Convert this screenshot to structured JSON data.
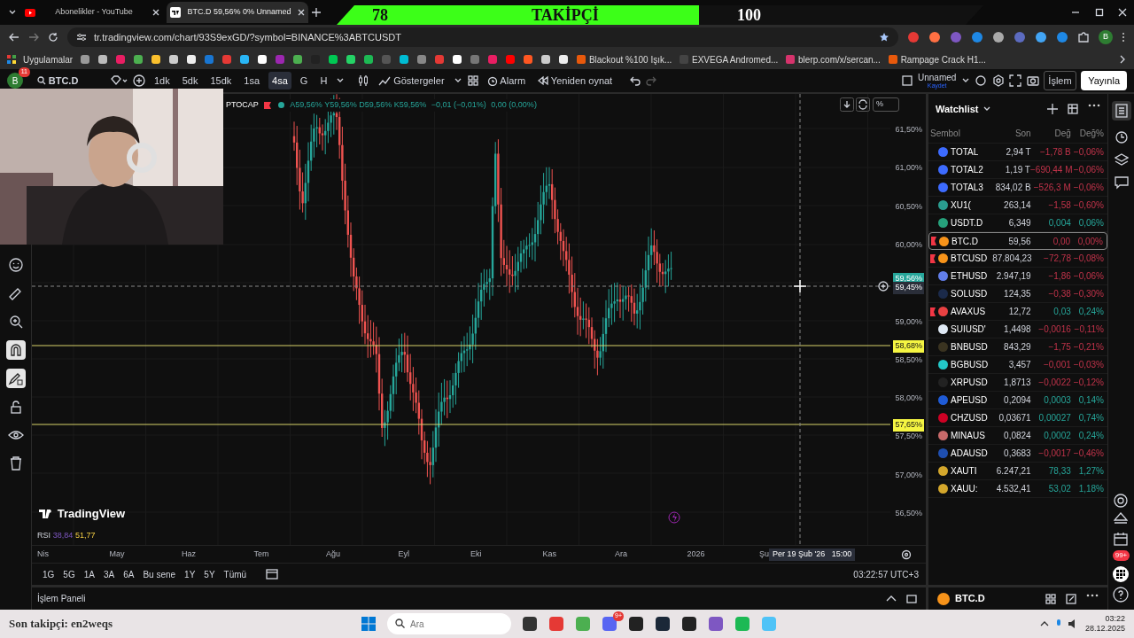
{
  "goal_banner": {
    "current": "78",
    "title": "TAKİPÇİ",
    "goal": "100",
    "level": 0.56
  },
  "browser": {
    "tabs": [
      {
        "title": "Abonelikler - YouTube",
        "kind": "youtube",
        "selected": false
      },
      {
        "title": "BTC.D 59,56% 0% Unnamed",
        "kind": "tradingview",
        "selected": true
      }
    ],
    "url": "tr.tradingview.com/chart/93S9exGD/?symbol=BINANCE%3ABTCUSDT",
    "profile_initial": "B",
    "apps_label": "Uygulamalar",
    "bookmarks": [
      {
        "title": "Blackout %100 Işık...",
        "color": "#e8590c"
      },
      {
        "title": "EXVEGA Andromed...",
        "color": "#444444"
      },
      {
        "title": "blerp.com/x/sercan...",
        "color": "#d6336c"
      },
      {
        "title": "Rampage Crack H1...",
        "color": "#e8590c"
      }
    ]
  },
  "toolbar": {
    "avatar": "B",
    "avatar_badge": "11",
    "symbol": "BTC.D",
    "intervals": [
      {
        "label": "1dk",
        "selected": false
      },
      {
        "label": "5dk",
        "selected": false
      },
      {
        "label": "15dk",
        "selected": false
      },
      {
        "label": "1sa",
        "selected": false
      },
      {
        "label": "4sa",
        "selected": true
      },
      {
        "label": "G",
        "selected": false
      },
      {
        "label": "H",
        "selected": false
      }
    ],
    "indicators": "Göstergeler",
    "alarm": "Alarm",
    "replay": "Yeniden oynat",
    "layout_name": "Unnamed",
    "layout_status": "Kaydet",
    "trade": "İşlem",
    "publish": "Yayınla"
  },
  "chart": {
    "symbol": "PTOCAP",
    "ohlc": [
      {
        "key": "A",
        "value": "59,56%"
      },
      {
        "key": "Y",
        "value": "59,56%"
      },
      {
        "key": "D",
        "value": "59,56%"
      },
      {
        "key": "K",
        "value": "59,56%"
      }
    ],
    "change": "−0,01 (−0,01%)",
    "volume": "0,00 (0,00%)",
    "scale_mode": "%",
    "price_ticks": [
      "61,50%",
      "61,00%",
      "60,50%",
      "60,00%",
      "59,00%",
      "58,50%",
      "58,00%",
      "57,50%",
      "57,00%",
      "56,50%"
    ],
    "last_price": "59,56%",
    "crosshair_price": "59,45%",
    "horizontal_lines": [
      {
        "label": "58,68%"
      },
      {
        "label": "57,65%"
      }
    ],
    "time_ticks": [
      "Nis",
      "May",
      "Haz",
      "Tem",
      "Ağu",
      "Eyl",
      "Eki",
      "Kas",
      "Ara",
      "2026",
      "Şu"
    ],
    "crosshair_time": "Per 19 Şub '26   15:00",
    "logo": "TradingView",
    "rsi": {
      "label": "RSI",
      "value_1": "38,84",
      "value_2": "51,77"
    },
    "ranges": [
      "1G",
      "5G",
      "1A",
      "3A",
      "6A",
      "Bu sene",
      "1Y",
      "5Y",
      "Tümü"
    ],
    "clock": "03:22:57 UTC+3"
  },
  "bottom_panel": {
    "title": "İşlem Paneli"
  },
  "watchlist": {
    "title": "Watchlist",
    "columns": [
      "Sembol",
      "Son",
      "Değ",
      "Değ%"
    ],
    "rows": [
      {
        "symbol": "TOTAL",
        "last": "2,94 T",
        "change": "−1,78 B",
        "change_pct": "−0,06%",
        "negative": true,
        "color": "#3d6bff",
        "flagged": false,
        "selected": false
      },
      {
        "symbol": "TOTAL2",
        "last": "1,19 T",
        "change": "−690,44 M",
        "change_pct": "−0,06%",
        "negative": true,
        "color": "#3d6bff",
        "flagged": false,
        "selected": false
      },
      {
        "symbol": "TOTAL3",
        "last": "834,02 B",
        "change": "−526,3 M",
        "change_pct": "−0,06%",
        "negative": true,
        "color": "#3d6bff",
        "flagged": false,
        "selected": false
      },
      {
        "symbol": "XU1(",
        "last": "263,14",
        "change": "−1,58",
        "change_pct": "−0,60%",
        "negative": true,
        "color": "#2a9d8f",
        "flagged": false,
        "selected": false
      },
      {
        "symbol": "USDT.D",
        "last": "6,349",
        "change": "0,004",
        "change_pct": "0,06%",
        "negative": false,
        "color": "#26a17b",
        "flagged": false,
        "selected": false
      },
      {
        "symbol": "BTC.D",
        "last": "59,56",
        "change": "0,00",
        "change_pct": "0,00%",
        "negative": true,
        "color": "#f7931a",
        "flagged": true,
        "selected": true
      },
      {
        "symbol": "BTCUSD",
        "last": "87.804,23",
        "change": "−72,78",
        "change_pct": "−0,08%",
        "negative": true,
        "color": "#f7931a",
        "flagged": true,
        "selected": false
      },
      {
        "symbol": "ETHUSD",
        "last": "2.947,19",
        "change": "−1,86",
        "change_pct": "−0,06%",
        "negative": true,
        "color": "#627eea",
        "flagged": false,
        "selected": false
      },
      {
        "symbol": "SOLUSD",
        "last": "124,35",
        "change": "−0,38",
        "change_pct": "−0,30%",
        "negative": true,
        "color": "#1b2a4a",
        "flagged": false,
        "selected": false
      },
      {
        "symbol": "AVAXUS",
        "last": "12,72",
        "change": "0,03",
        "change_pct": "0,24%",
        "negative": false,
        "color": "#e84142",
        "flagged": true,
        "selected": false
      },
      {
        "symbol": "SUIUSD'",
        "last": "1,4498",
        "change": "−0,0016",
        "change_pct": "−0,11%",
        "negative": true,
        "color": "#dfe9f5",
        "flagged": false,
        "selected": false
      },
      {
        "symbol": "BNBUSD",
        "last": "843,29",
        "change": "−1,75",
        "change_pct": "−0,21%",
        "negative": true,
        "color": "#3a3320",
        "flagged": false,
        "selected": false
      },
      {
        "symbol": "BGBUSD",
        "last": "3,457",
        "change": "−0,001",
        "change_pct": "−0,03%",
        "negative": true,
        "color": "#23c8c8",
        "flagged": false,
        "selected": false
      },
      {
        "symbol": "XRPUSD",
        "last": "1,8713",
        "change": "−0,0022",
        "change_pct": "−0,12%",
        "negative": true,
        "color": "#222222",
        "flagged": false,
        "selected": false
      },
      {
        "symbol": "APEUSD",
        "last": "0,2094",
        "change": "0,0003",
        "change_pct": "0,14%",
        "negative": false,
        "color": "#1f5bd6",
        "flagged": false,
        "selected": false
      },
      {
        "symbol": "CHZUSD",
        "last": "0,03671",
        "change": "0,00027",
        "change_pct": "0,74%",
        "negative": false,
        "color": "#cd0124",
        "flagged": false,
        "selected": false
      },
      {
        "symbol": "MINAUS",
        "last": "0,0824",
        "change": "0,0002",
        "change_pct": "0,24%",
        "negative": false,
        "color": "#c86a6a",
        "flagged": false,
        "selected": false
      },
      {
        "symbol": "ADAUSD",
        "last": "0,3683",
        "change": "−0,0017",
        "change_pct": "−0,46%",
        "negative": true,
        "color": "#1f4fb0",
        "flagged": false,
        "selected": false
      },
      {
        "symbol": "XAUTI",
        "last": "6.247,21",
        "change": "78,33",
        "change_pct": "1,27%",
        "negative": false,
        "color": "#d4a72c",
        "flagged": false,
        "selected": false
      },
      {
        "symbol": "XAUU:",
        "last": "4.532,41",
        "change": "53,02",
        "change_pct": "1,18%",
        "negative": false,
        "color": "#d4a72c",
        "flagged": false,
        "selected": false
      }
    ],
    "footer_symbol": "BTC.D"
  },
  "side_bar": {
    "notification_badge": "99+"
  },
  "taskbar": {
    "follower_overlay": "Son takipçi: en2weqs",
    "search_placeholder": "Ara",
    "app_badge": "9+",
    "time": "03:22",
    "date": "28.12.2025"
  }
}
